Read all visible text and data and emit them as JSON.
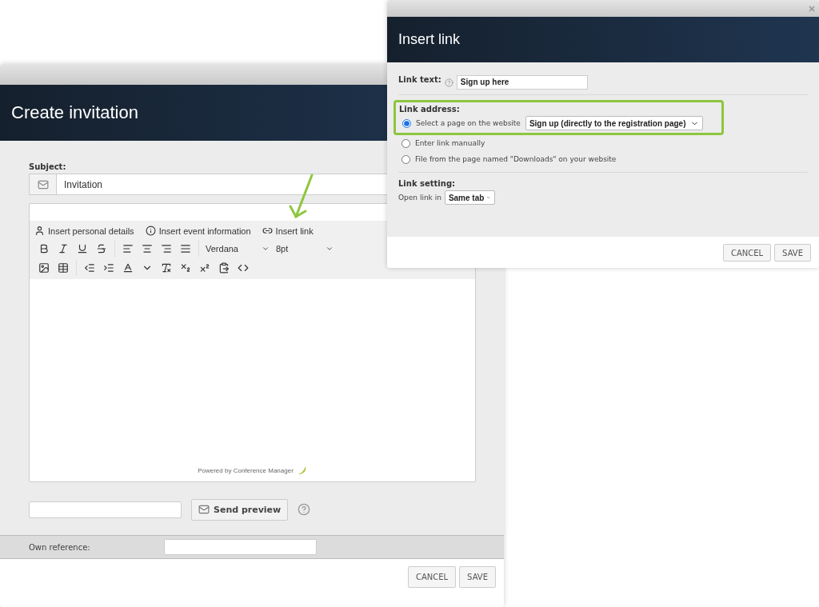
{
  "invitation": {
    "title": "Create invitation",
    "subject_label": "Subject:",
    "subject_value": "Invitation",
    "insert_items": [
      {
        "kind": "person",
        "label": "Insert personal details"
      },
      {
        "kind": "info",
        "label": "Insert event information"
      },
      {
        "kind": "link",
        "label": "Insert link"
      }
    ],
    "font": "Verdana",
    "size": "8pt",
    "powered_by": "Powered by Conference Manager",
    "preview_button": "Send preview",
    "own_reference_label": "Own reference:",
    "buttons": [
      "CANCEL",
      "SAVE"
    ]
  },
  "insert_link": {
    "title": "Insert link",
    "link_text_label": "Link text:",
    "link_text_value": "Sign up here",
    "link_address_label": "Link address:",
    "options": [
      {
        "kind": "with_select",
        "label": "Select a page on the website",
        "selected": true,
        "select_value": "Sign up (directly to the registration page)"
      },
      {
        "kind": "plain",
        "label": "Enter link manually",
        "selected": false
      },
      {
        "kind": "plain",
        "label": "File from the page named \"Downloads\" on your website",
        "selected": false
      }
    ],
    "link_setting_label": "Link setting:",
    "open_link_label": "Open link in",
    "open_link_value": "Same tab",
    "buttons": [
      "CANCEL",
      "SAVE"
    ]
  }
}
